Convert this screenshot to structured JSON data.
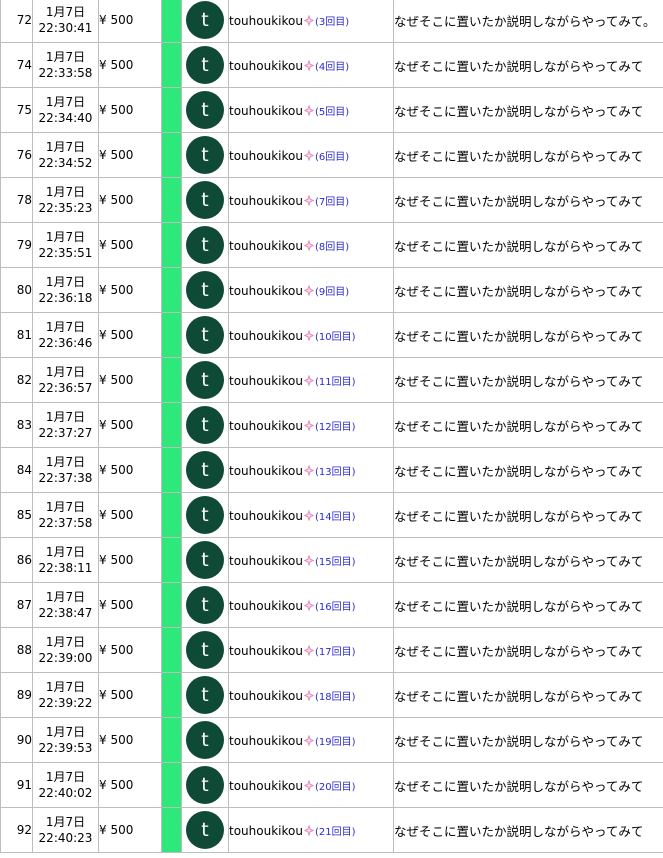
{
  "colors": {
    "accent_bar": "#2ee87b",
    "avatar_bg": "#0e4a36",
    "count_link": "#2a2ad0"
  },
  "icons": {
    "user_badge": "sparkle-icon"
  },
  "rows": [
    {
      "num": "72",
      "date": "1月7日",
      "time": "22:30:41",
      "amount": "¥ 500",
      "avatar": "t",
      "user": "touhoukikou",
      "count": "(3回目)",
      "message": "なぜそこに置いたか説明しながらやってみて。"
    },
    {
      "num": "74",
      "date": "1月7日",
      "time": "22:33:58",
      "amount": "¥ 500",
      "avatar": "t",
      "user": "touhoukikou",
      "count": "(4回目)",
      "message": "なぜそこに置いたか説明しながらやってみて"
    },
    {
      "num": "75",
      "date": "1月7日",
      "time": "22:34:40",
      "amount": "¥ 500",
      "avatar": "t",
      "user": "touhoukikou",
      "count": "(5回目)",
      "message": "なぜそこに置いたか説明しながらやってみて"
    },
    {
      "num": "76",
      "date": "1月7日",
      "time": "22:34:52",
      "amount": "¥ 500",
      "avatar": "t",
      "user": "touhoukikou",
      "count": "(6回目)",
      "message": "なぜそこに置いたか説明しながらやってみて"
    },
    {
      "num": "78",
      "date": "1月7日",
      "time": "22:35:23",
      "amount": "¥ 500",
      "avatar": "t",
      "user": "touhoukikou",
      "count": "(7回目)",
      "message": "なぜそこに置いたか説明しながらやってみて"
    },
    {
      "num": "79",
      "date": "1月7日",
      "time": "22:35:51",
      "amount": "¥ 500",
      "avatar": "t",
      "user": "touhoukikou",
      "count": "(8回目)",
      "message": "なぜそこに置いたか説明しながらやってみて"
    },
    {
      "num": "80",
      "date": "1月7日",
      "time": "22:36:18",
      "amount": "¥ 500",
      "avatar": "t",
      "user": "touhoukikou",
      "count": "(9回目)",
      "message": "なぜそこに置いたか説明しながらやってみて"
    },
    {
      "num": "81",
      "date": "1月7日",
      "time": "22:36:46",
      "amount": "¥ 500",
      "avatar": "t",
      "user": "touhoukikou",
      "count": "(10回目)",
      "message": "なぜそこに置いたか説明しながらやってみて"
    },
    {
      "num": "82",
      "date": "1月7日",
      "time": "22:36:57",
      "amount": "¥ 500",
      "avatar": "t",
      "user": "touhoukikou",
      "count": "(11回目)",
      "message": "なぜそこに置いたか説明しながらやってみて"
    },
    {
      "num": "83",
      "date": "1月7日",
      "time": "22:37:27",
      "amount": "¥ 500",
      "avatar": "t",
      "user": "touhoukikou",
      "count": "(12回目)",
      "message": "なぜそこに置いたか説明しながらやってみて"
    },
    {
      "num": "84",
      "date": "1月7日",
      "time": "22:37:38",
      "amount": "¥ 500",
      "avatar": "t",
      "user": "touhoukikou",
      "count": "(13回目)",
      "message": "なぜそこに置いたか説明しながらやってみて"
    },
    {
      "num": "85",
      "date": "1月7日",
      "time": "22:37:58",
      "amount": "¥ 500",
      "avatar": "t",
      "user": "touhoukikou",
      "count": "(14回目)",
      "message": "なぜそこに置いたか説明しながらやってみて"
    },
    {
      "num": "86",
      "date": "1月7日",
      "time": "22:38:11",
      "amount": "¥ 500",
      "avatar": "t",
      "user": "touhoukikou",
      "count": "(15回目)",
      "message": "なぜそこに置いたか説明しながらやってみて"
    },
    {
      "num": "87",
      "date": "1月7日",
      "time": "22:38:47",
      "amount": "¥ 500",
      "avatar": "t",
      "user": "touhoukikou",
      "count": "(16回目)",
      "message": "なぜそこに置いたか説明しながらやってみて"
    },
    {
      "num": "88",
      "date": "1月7日",
      "time": "22:39:00",
      "amount": "¥ 500",
      "avatar": "t",
      "user": "touhoukikou",
      "count": "(17回目)",
      "message": "なぜそこに置いたか説明しながらやってみて"
    },
    {
      "num": "89",
      "date": "1月7日",
      "time": "22:39:22",
      "amount": "¥ 500",
      "avatar": "t",
      "user": "touhoukikou",
      "count": "(18回目)",
      "message": "なぜそこに置いたか説明しながらやってみて"
    },
    {
      "num": "90",
      "date": "1月7日",
      "time": "22:39:53",
      "amount": "¥ 500",
      "avatar": "t",
      "user": "touhoukikou",
      "count": "(19回目)",
      "message": "なぜそこに置いたか説明しながらやってみて"
    },
    {
      "num": "91",
      "date": "1月7日",
      "time": "22:40:02",
      "amount": "¥ 500",
      "avatar": "t",
      "user": "touhoukikou",
      "count": "(20回目)",
      "message": "なぜそこに置いたか説明しながらやってみて"
    },
    {
      "num": "92",
      "date": "1月7日",
      "time": "22:40:23",
      "amount": "¥ 500",
      "avatar": "t",
      "user": "touhoukikou",
      "count": "(21回目)",
      "message": "なぜそこに置いたか説明しながらやってみて"
    }
  ]
}
